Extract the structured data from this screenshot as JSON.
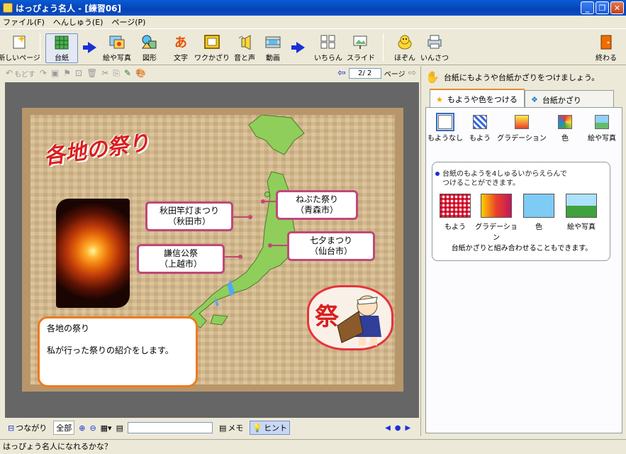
{
  "window": {
    "title": "はっぴょう名人 - [練習06]"
  },
  "menu": [
    "ファイル(F)",
    "へんしゅう(E)",
    "ページ(P)"
  ],
  "toolbar": {
    "new_page": "新しいページ",
    "daishi": "台紙",
    "e_shashin": "絵や写真",
    "zukei": "図形",
    "moji": "文字",
    "wakazari": "ワクかざり",
    "oto": "音と声",
    "douga": "動画",
    "ichiran": "いちらん",
    "slide": "スライド",
    "hozon": "ほぞん",
    "insatsu": "いんさつ",
    "owaru": "終わる"
  },
  "edit_toolbar": {
    "undo": "もどす",
    "page_value": "2/ 2",
    "page_label": "ページ"
  },
  "slide": {
    "title": "各地の祭り",
    "callouts": [
      {
        "line1": "秋田竿灯まつり",
        "line2": "（秋田市）"
      },
      {
        "line1": "ねぶた祭り",
        "line2": "（青森市）"
      },
      {
        "line1": "七夕まつり",
        "line2": "（仙台市）"
      },
      {
        "line1": "謙信公祭",
        "line2": "（上越市）"
      }
    ],
    "note_title": "各地の祭り",
    "note_body": "私が行った祭りの紹介をします。",
    "mascot_kanji": "祭"
  },
  "rpane": {
    "hint": "台紙にもようや台紙かざりをつけましょう。",
    "tabs": [
      "もようや色をつける",
      "台紙かざり"
    ],
    "options": [
      "もようなし",
      "もよう",
      "グラデーション",
      "色",
      "絵や写真"
    ],
    "info_line1": "台紙のもようを4しゅるいからえらんで",
    "info_line2": "つけることができます。",
    "thumbs": [
      "もよう",
      "グラデーション",
      "色",
      "絵や写真"
    ],
    "footer": "台紙かざりと組み合わせることもできます。"
  },
  "bottombar": {
    "tsunagari": "つながり",
    "zenbu": "全部",
    "memo": "メモ",
    "hint": "ヒント"
  },
  "status": "はっぴょう名人になれるかな？",
  "colors": {
    "accent_blue": "#1b2fd8",
    "callout_border": "#c0487a",
    "note_border": "#f07a20",
    "title_red": "#d92020"
  }
}
